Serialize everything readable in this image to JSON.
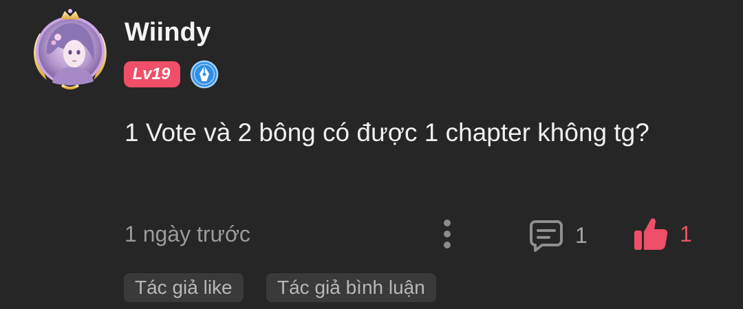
{
  "comment": {
    "username": "Wiindy",
    "level_badge": "Lv19",
    "text": "1 Vote và 2 bông có được 1 chapter không tg?",
    "timestamp": "1 ngày trước",
    "reply_count": "1",
    "like_count": "1",
    "tags": [
      "Tác giả like",
      "Tác giả bình luận"
    ]
  },
  "icons": {
    "avatar": "avatar-image",
    "author_badge": "pen-nib-icon",
    "more": "more-vertical-icon",
    "reply": "comment-icon",
    "like": "thumbs-up-icon"
  },
  "colors": {
    "background": "#262626",
    "accent": "#ef4f68",
    "muted_text": "#9b9b9b",
    "tag_background": "#3a3a3a",
    "badge_blue": "#2f8fe6"
  }
}
